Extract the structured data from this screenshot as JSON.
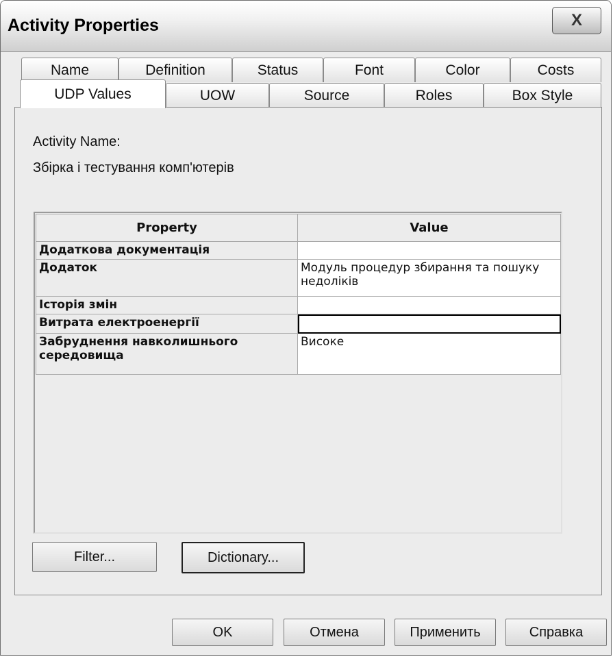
{
  "window": {
    "title": "Activity Properties",
    "close_glyph": "X"
  },
  "tabs": {
    "row_back": [
      "Name",
      "Definition",
      "Status",
      "Font",
      "Color",
      "Costs"
    ],
    "row_front": [
      "UDP Values",
      "UOW",
      "Source",
      "Roles",
      "Box Style"
    ],
    "active": "UDP Values"
  },
  "activity": {
    "name_label": "Activity Name:",
    "name_value": "Збірка і тестування комп'ютерів"
  },
  "grid": {
    "headers": [
      "Property",
      "Value"
    ],
    "rows": [
      {
        "property": "Додаткова документація",
        "value": ""
      },
      {
        "property": "Додаток",
        "value": "Модуль процедур збирання та пошуку недоліків"
      },
      {
        "property": "Історія змін",
        "value": ""
      },
      {
        "property": "Витрата електроенергії",
        "value": ""
      },
      {
        "property": "Забруднення навколишнього середовища",
        "value": "Високе"
      }
    ]
  },
  "panel_buttons": {
    "filter": "Filter...",
    "dictionary": "Dictionary..."
  },
  "dialog_buttons": {
    "ok": "OK",
    "cancel": "Отмена",
    "apply": "Применить",
    "help": "Справка"
  },
  "icons": {
    "close": "close-icon"
  },
  "colors": {
    "dialog_bg": "#ececec",
    "cell_bg": "#ffffff",
    "border": "#8a8a8a"
  }
}
